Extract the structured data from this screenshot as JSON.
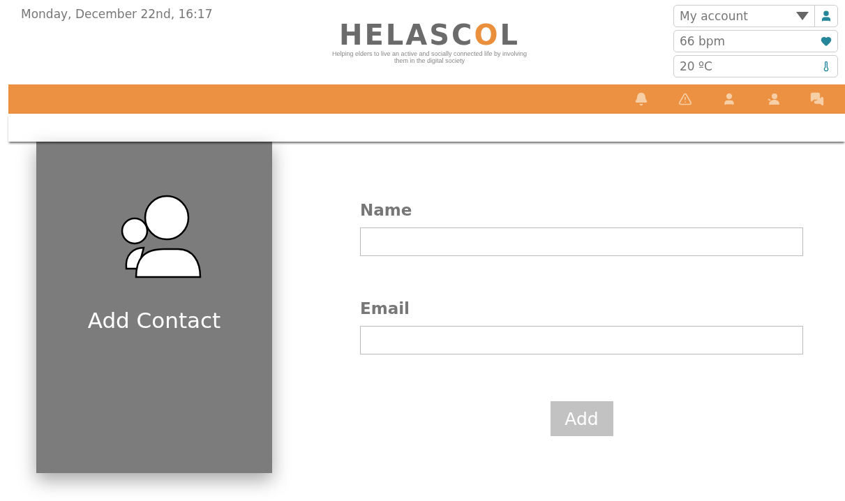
{
  "header": {
    "date": "Monday, December 22nd, 16:17",
    "logo": {
      "parts": [
        {
          "text": "HELASC",
          "color": "#6b6b6b"
        },
        {
          "text": "O",
          "color": "#ea8f3c"
        },
        {
          "text": "L",
          "color": "#6b6b6b"
        }
      ],
      "tagline": "Helping elders to live an active and socially connected life by involving them in the digital society"
    },
    "widgets": [
      {
        "kind": "account",
        "value": "My account"
      },
      {
        "kind": "heart",
        "value": "66 bpm"
      },
      {
        "kind": "temperature",
        "value": "20 ºC"
      }
    ]
  },
  "navbar": {
    "icons": [
      {
        "kind": "bell"
      },
      {
        "kind": "warning"
      },
      {
        "kind": "user"
      },
      {
        "kind": "contacts"
      },
      {
        "kind": "chat"
      }
    ]
  },
  "card": {
    "title": "Add Contact"
  },
  "form": {
    "fields": [
      {
        "label": "Name"
      },
      {
        "label": "Email"
      }
    ],
    "button": "Add"
  }
}
